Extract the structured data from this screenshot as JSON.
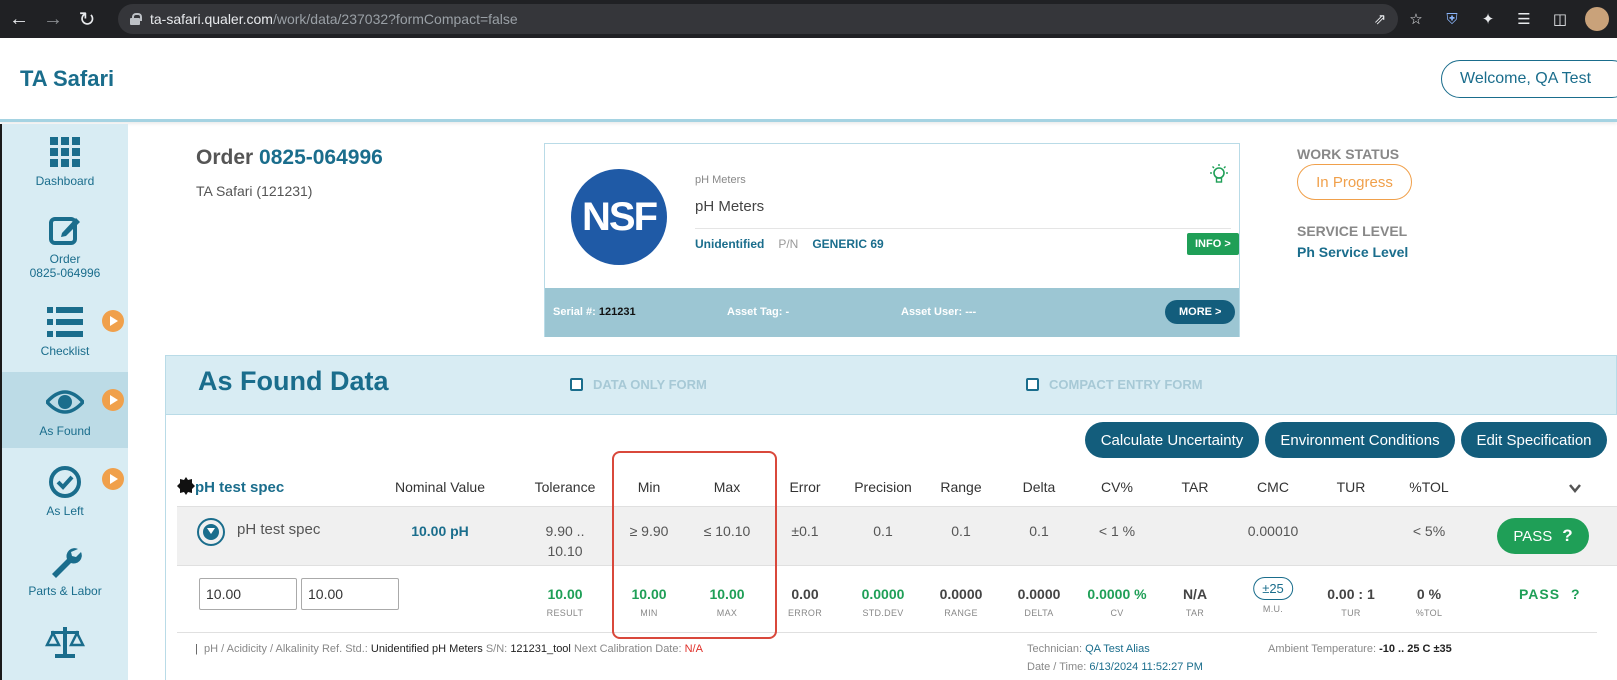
{
  "browser": {
    "url_host": "ta-safari.qualer.com",
    "url_path": "/work/data/237032?formCompact=false"
  },
  "header": {
    "brand": "TA Safari",
    "welcome": "Welcome, QA Test"
  },
  "sidebar": {
    "items": [
      {
        "label": "Dashboard",
        "sublabel": ""
      },
      {
        "label": "Order",
        "sublabel": "0825-064996"
      },
      {
        "label": "Checklist",
        "sublabel": ""
      },
      {
        "label": "As Found",
        "sublabel": ""
      },
      {
        "label": "As Left",
        "sublabel": ""
      },
      {
        "label": "Parts & Labor",
        "sublabel": ""
      }
    ]
  },
  "order": {
    "prefix": "Order",
    "number": "0825-064996",
    "client": "TA Safari (121231)"
  },
  "asset": {
    "logo_text": "NSF",
    "category": "pH Meters",
    "name": "pH Meters",
    "manufacturer": "Unidentified",
    "pn_label": "P/N",
    "model": "GENERIC 69",
    "info_label": "INFO >",
    "serial_label": "Serial #:",
    "serial": "121231",
    "tag_label": "Asset Tag:",
    "tag": "-",
    "user_label": "Asset User:",
    "user": "---",
    "more_label": "MORE >"
  },
  "status": {
    "work_status_label": "WORK STATUS",
    "work_status": "In Progress",
    "service_level_label": "SERVICE LEVEL",
    "service_level": "Ph Service Level"
  },
  "section": {
    "title": "As Found Data",
    "data_only_label": "DATA ONLY FORM",
    "compact_label": "COMPACT ENTRY FORM"
  },
  "actions": {
    "calc_uncertainty": "Calculate Uncertainty",
    "env_conditions": "Environment Conditions",
    "edit_spec": "Edit Specification"
  },
  "table": {
    "spec_title": "pH test spec",
    "headers": [
      "Nominal Value",
      "Tolerance",
      "Min",
      "Max",
      "Error",
      "Precision",
      "Range",
      "Delta",
      "CV%",
      "TAR",
      "CMC",
      "TUR",
      "%TOL"
    ],
    "spec_row": {
      "name": "pH test spec",
      "nominal": "10.00 pH",
      "tol_line1": "9.90 ..",
      "tol_line2": "10.10",
      "min": "≥ 9.90",
      "max": "≤ 10.10",
      "error": "±0.1",
      "precision": "0.1",
      "range": "0.1",
      "delta": "0.1",
      "cv": "< 1 %",
      "tar": "",
      "cmc": "0.00010",
      "tur": "",
      "tol_pct": "< 5%",
      "result": "PASS",
      "q": "?"
    },
    "reading_row": {
      "input1": "10.00",
      "input2": "10.00",
      "result": "10.00",
      "result_label": "RESULT",
      "min": "10.00",
      "min_label": "MIN",
      "max": "10.00",
      "max_label": "MAX",
      "error": "0.00",
      "error_label": "ERROR",
      "stddev": "0.0000",
      "stddev_label": "STD.DEV",
      "range": "0.0000",
      "range_label": "RANGE",
      "delta": "0.0000",
      "delta_label": "DELTA",
      "cv": "0.0000 %",
      "cv_label": "CV",
      "tar": "N/A",
      "tar_label": "TAR",
      "mu": "±25",
      "mu_label": "M.U.",
      "tur": "0.00 : 1",
      "tur_label": "TUR",
      "tol": "0 %",
      "tol_label": "%TOL",
      "result_text": "PASS",
      "q": "?"
    }
  },
  "footer": {
    "ref_label": "pH / Acidicity / Alkalinity Ref. Std.:",
    "ref_value": "Unidentified pH Meters",
    "sn_label": "S/N:",
    "sn_value": "121231_tool",
    "next_cal_label": "Next Calibration Date:",
    "next_cal_value": "N/A",
    "tech_label": "Technician:",
    "tech_value": "QA Test Alias",
    "dt_label": "Date / Time:",
    "dt_value": "6/13/2024 11:52:27 PM",
    "temp_label": "Ambient Temperature:",
    "temp_value": "-10 .. 25 C ±35"
  },
  "colors": {
    "brand": "#1a6d8c",
    "pass": "#1f9f57",
    "status": "#f0a04b",
    "highlight": "#d9483b"
  }
}
